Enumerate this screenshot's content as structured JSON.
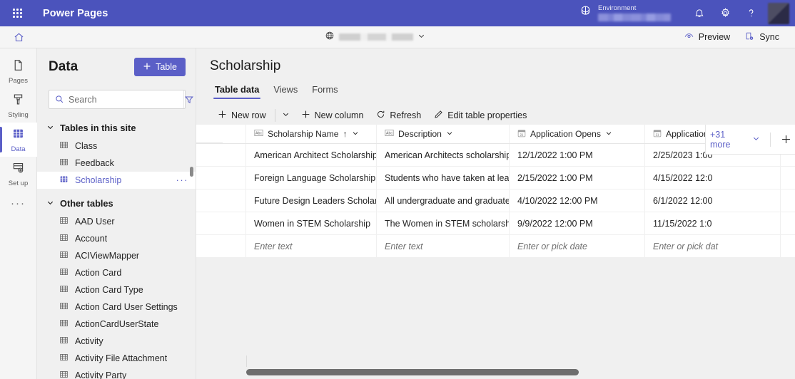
{
  "brand": {
    "waffle_icon": "app-launcher-icon",
    "title": "Power Pages",
    "env_label": "Environment",
    "env_value": "",
    "globe_icon": "environment-icon",
    "bell_icon": "notifications-icon",
    "gear_icon": "settings-icon",
    "help_icon": "help-icon",
    "avatar": "user-avatar"
  },
  "toolbar": {
    "home_icon": "home-icon",
    "site_name": "",
    "site_globe_icon": "globe-icon",
    "preview_label": "Preview",
    "sync_label": "Sync"
  },
  "rail": {
    "items": [
      {
        "label": "Pages",
        "icon": "page-icon",
        "active": false
      },
      {
        "label": "Styling",
        "icon": "brush-icon",
        "active": false
      },
      {
        "label": "Data",
        "icon": "table-icon",
        "active": true
      },
      {
        "label": "Set up",
        "icon": "setup-icon",
        "active": false
      }
    ],
    "more_label": "···"
  },
  "data_panel": {
    "title": "Data",
    "new_table_label": "Table",
    "search_placeholder": "Search",
    "search_value": "",
    "filter_icon": "filter-icon",
    "groups": [
      {
        "label": "Tables in this site",
        "expanded": true,
        "tables": [
          {
            "name": "Class",
            "selected": false
          },
          {
            "name": "Feedback",
            "selected": false
          },
          {
            "name": "Scholarship",
            "selected": true,
            "overflow": "···"
          }
        ]
      },
      {
        "label": "Other tables",
        "expanded": true,
        "tables": [
          {
            "name": "AAD User",
            "selected": false
          },
          {
            "name": "Account",
            "selected": false
          },
          {
            "name": "ACIViewMapper",
            "selected": false
          },
          {
            "name": "Action Card",
            "selected": false
          },
          {
            "name": "Action Card Type",
            "selected": false
          },
          {
            "name": "Action Card User Settings",
            "selected": false
          },
          {
            "name": "ActionCardUserState",
            "selected": false
          },
          {
            "name": "Activity",
            "selected": false
          },
          {
            "name": "Activity File Attachment",
            "selected": false
          },
          {
            "name": "Activity Party",
            "selected": false
          }
        ]
      }
    ]
  },
  "main": {
    "page_title": "Scholarship",
    "tabs": [
      {
        "label": "Table data",
        "active": true
      },
      {
        "label": "Views",
        "active": false
      },
      {
        "label": "Forms",
        "active": false
      }
    ],
    "commands": [
      {
        "label": "New row",
        "icon": "plus-icon"
      },
      {
        "label": "",
        "icon": "chevron-down-icon",
        "split": true
      },
      {
        "label": "New column",
        "icon": "plus-icon"
      },
      {
        "label": "Refresh",
        "icon": "refresh-icon"
      },
      {
        "label": "Edit table properties",
        "icon": "pencil-icon"
      }
    ]
  },
  "grid": {
    "columns": [
      {
        "label": "Scholarship Name",
        "type_icon": "text-column-icon",
        "sorted": "asc",
        "sort_glyph": "↑"
      },
      {
        "label": "Description",
        "type_icon": "text-column-icon",
        "sorted": ""
      },
      {
        "label": "Application Opens",
        "type_icon": "date-column-icon",
        "sorted": ""
      },
      {
        "label": "Application D",
        "type_icon": "date-column-icon",
        "sorted": ""
      }
    ],
    "rows": [
      {
        "name": "American Architect Scholarship",
        "description": "American Architects scholarship is...",
        "opens": "12/1/2022 1:00 PM",
        "due": "2/25/2023 1:00"
      },
      {
        "name": "Foreign Language Scholarship",
        "description": "Students who have taken at least ...",
        "opens": "2/15/2022 1:00 PM",
        "due": "4/15/2022 12:0"
      },
      {
        "name": "Future Design Leaders Scholarship",
        "description": "All undergraduate and graduate s...",
        "opens": "4/10/2022 12:00 PM",
        "due": "6/1/2022 12:00"
      },
      {
        "name": "Women in STEM Scholarship",
        "description": "The Women in STEM scholarship i...",
        "opens": "9/9/2022 12:00 PM",
        "due": "11/15/2022 1:0"
      }
    ],
    "new_row": {
      "name_placeholder": "Enter text",
      "description_placeholder": "Enter text",
      "opens_placeholder": "Enter or pick date",
      "due_placeholder": "Enter or pick dat"
    },
    "more_columns_label": "+31 more",
    "add_column_icon": "plus-icon"
  },
  "colors": {
    "brand_purple": "#4b53bc",
    "accent": "#5b5fc7",
    "surface": "#ffffff",
    "canvas": "#f0f0f0"
  }
}
